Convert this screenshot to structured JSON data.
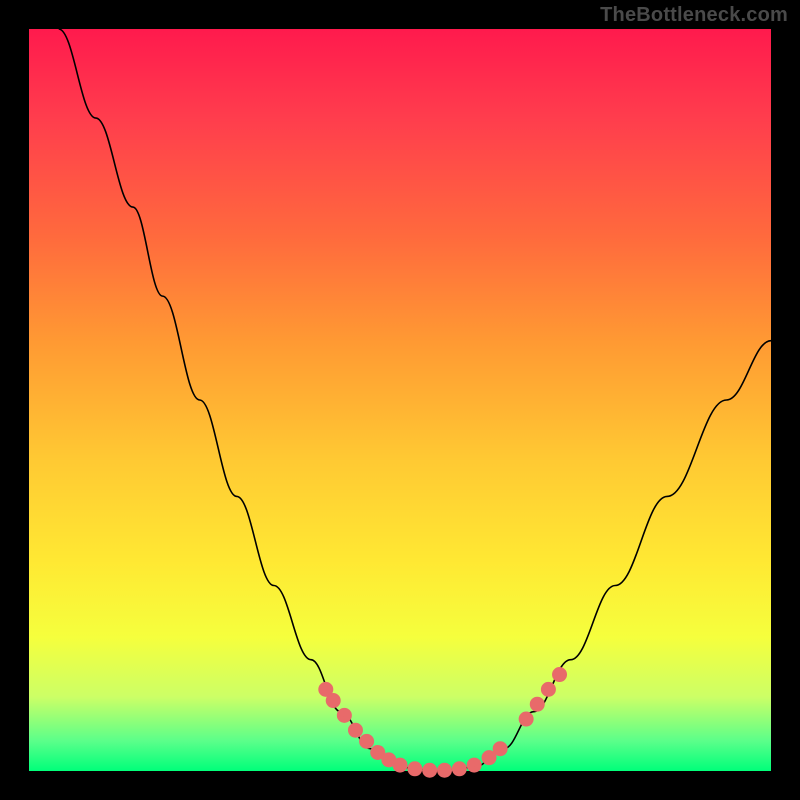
{
  "attribution": "TheBottleneck.com",
  "chart_data": {
    "type": "line",
    "title": "",
    "xlabel": "",
    "ylabel": "",
    "xlim": [
      0,
      100
    ],
    "ylim": [
      0,
      100
    ],
    "curve_points": [
      {
        "x": 4,
        "y": 100
      },
      {
        "x": 9,
        "y": 88
      },
      {
        "x": 14,
        "y": 76
      },
      {
        "x": 18,
        "y": 64
      },
      {
        "x": 23,
        "y": 50
      },
      {
        "x": 28,
        "y": 37
      },
      {
        "x": 33,
        "y": 25
      },
      {
        "x": 38,
        "y": 15
      },
      {
        "x": 42,
        "y": 8
      },
      {
        "x": 46,
        "y": 3
      },
      {
        "x": 50,
        "y": 0.5
      },
      {
        "x": 55,
        "y": 0
      },
      {
        "x": 60,
        "y": 0.5
      },
      {
        "x": 64,
        "y": 3
      },
      {
        "x": 68,
        "y": 8
      },
      {
        "x": 73,
        "y": 15
      },
      {
        "x": 79,
        "y": 25
      },
      {
        "x": 86,
        "y": 37
      },
      {
        "x": 94,
        "y": 50
      },
      {
        "x": 100,
        "y": 58
      }
    ],
    "marker_clusters": [
      [
        {
          "x": 40,
          "y": 11
        },
        {
          "x": 41,
          "y": 9.5
        },
        {
          "x": 42.5,
          "y": 7.5
        },
        {
          "x": 44,
          "y": 5.5
        },
        {
          "x": 45.5,
          "y": 4
        },
        {
          "x": 47,
          "y": 2.5
        },
        {
          "x": 48.5,
          "y": 1.5
        },
        {
          "x": 50,
          "y": 0.8
        },
        {
          "x": 52,
          "y": 0.3
        },
        {
          "x": 54,
          "y": 0.1
        },
        {
          "x": 56,
          "y": 0.1
        },
        {
          "x": 58,
          "y": 0.3
        },
        {
          "x": 60,
          "y": 0.8
        },
        {
          "x": 62,
          "y": 1.8
        },
        {
          "x": 63.5,
          "y": 3
        }
      ],
      [
        {
          "x": 67,
          "y": 7
        },
        {
          "x": 68.5,
          "y": 9
        },
        {
          "x": 70,
          "y": 11
        },
        {
          "x": 71.5,
          "y": 13
        }
      ]
    ],
    "gradient_stops": [
      {
        "pct": 0,
        "color": "#ff1a4d"
      },
      {
        "pct": 12,
        "color": "#ff3d4d"
      },
      {
        "pct": 28,
        "color": "#ff6a3d"
      },
      {
        "pct": 42,
        "color": "#ff9933"
      },
      {
        "pct": 58,
        "color": "#ffc933"
      },
      {
        "pct": 72,
        "color": "#ffe933"
      },
      {
        "pct": 82,
        "color": "#f5ff3d"
      },
      {
        "pct": 90,
        "color": "#ccff66"
      },
      {
        "pct": 96,
        "color": "#5aff8a"
      },
      {
        "pct": 100,
        "color": "#00ff7a"
      }
    ]
  }
}
